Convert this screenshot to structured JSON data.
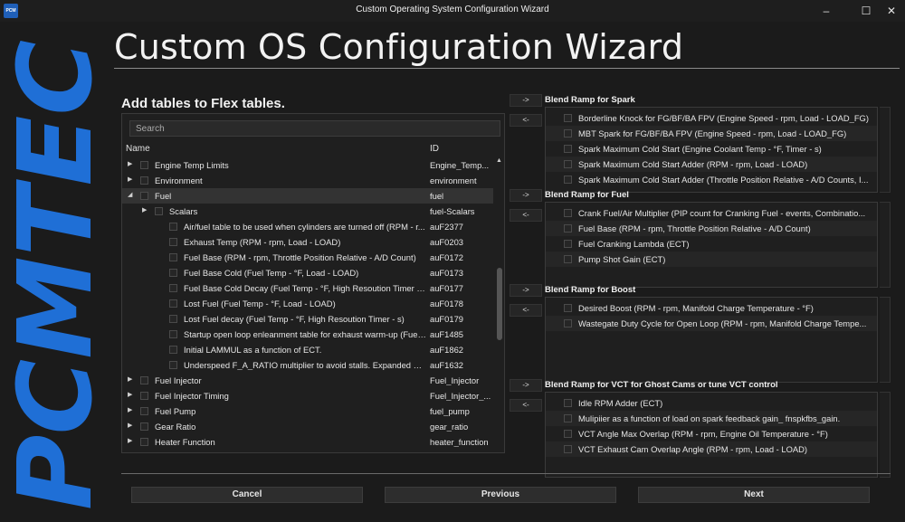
{
  "window": {
    "title": "Custom Operating System Configuration Wizard",
    "icon_text": "PCM",
    "min": "–",
    "max": "☐",
    "close": "✕"
  },
  "logo": {
    "text": "PCMTEC",
    "color": "#1f6fd6"
  },
  "header": {
    "title": "Custom OS Configuration Wizard"
  },
  "tables": {
    "heading": "Add tables to Flex tables.",
    "search_placeholder": "Search",
    "col_name": "Name",
    "col_id": "ID",
    "rows": [
      {
        "name": "Engine Temp Limits",
        "id": "Engine_Temp...",
        "level": 0,
        "expander": "▶"
      },
      {
        "name": "Environment",
        "id": "environment",
        "level": 0,
        "expander": "▶"
      },
      {
        "name": "Fuel",
        "id": "fuel",
        "level": 0,
        "expander": "◢",
        "selected": true
      },
      {
        "name": "Scalars",
        "id": "fuel-Scalars",
        "level": 1,
        "expander": "▶"
      },
      {
        "name": "Air/fuel table to be used when cylinders are turned off (RPM - r...",
        "id": "auF2377",
        "level": 2
      },
      {
        "name": "Exhaust Temp (RPM - rpm, Load - LOAD)",
        "id": "auF0203",
        "level": 2
      },
      {
        "name": "Fuel Base (RPM - rpm, Throttle Position Relative - A/D Count)",
        "id": "auF0172",
        "level": 2
      },
      {
        "name": "Fuel Base Cold (Fuel Temp - °F, Load - LOAD)",
        "id": "auF0173",
        "level": 2
      },
      {
        "name": "Fuel Base Cold Decay (Fuel Temp - °F, High Resoution Timer - s)",
        "id": "auF0177",
        "level": 2
      },
      {
        "name": "Lost Fuel (Fuel Temp - °F, Load - LOAD)",
        "id": "auF0178",
        "level": 2
      },
      {
        "name": "Lost Fuel decay (Fuel Temp - °F, High Resoution Timer - s)",
        "id": "auF0179",
        "level": 2
      },
      {
        "name": "Startup open loop enleanment table for exhaust warm-up  (Fuel...",
        "id": "auF1485",
        "level": 2
      },
      {
        "name": "Initial LAMMUL as a function of ECT.",
        "id": "auF1862",
        "level": 2
      },
      {
        "name": "Underspeed F_A_RATIO multiplier to avoid stalls. Expanded brea...",
        "id": "auF1632",
        "level": 2
      },
      {
        "name": "Fuel Injector",
        "id": "Fuel_Injector",
        "level": 0,
        "expander": "▶"
      },
      {
        "name": "Fuel Injector Timing",
        "id": "Fuel_Injector_...",
        "level": 0,
        "expander": "▶"
      },
      {
        "name": "Fuel Pump",
        "id": "fuel_pump",
        "level": 0,
        "expander": "▶"
      },
      {
        "name": "Gear Ratio",
        "id": "gear_ratio",
        "level": 0,
        "expander": "▶"
      },
      {
        "name": "Heater Function",
        "id": "heater_function",
        "level": 0,
        "expander": "▶"
      }
    ]
  },
  "move": {
    "add": "->",
    "remove": "<-"
  },
  "blends": [
    {
      "title": "Blend Ramp for Spark",
      "items": [
        "Borderline Knock for FG/BF/BA FPV (Engine Speed - rpm, Load - LOAD_FG)",
        "MBT Spark for FG/BF/BA FPV (Engine Speed - rpm, Load - LOAD_FG)",
        "Spark Maximum Cold Start (Engine Coolant Temp - °F, Timer - s)",
        "Spark Maximum Cold Start Adder (RPM - rpm, Load - LOAD)",
        "Spark Maximum Cold Start Adder (Throttle Position Relative - A/D Counts, I..."
      ]
    },
    {
      "title": "Blend Ramp for Fuel",
      "items": [
        "Crank Fuel/Air Multiplier (PIP count for Cranking Fuel - events, Combinatio...",
        "Fuel Base (RPM - rpm, Throttle Position Relative - A/D Count)",
        "Fuel Cranking Lambda (ECT)",
        "Pump Shot Gain (ECT)"
      ]
    },
    {
      "title": "Blend Ramp for Boost",
      "items": [
        "Desired Boost (RPM - rpm, Manifold Charge Temperature - °F)",
        "Wastegate Duty Cycle for Open Loop (RPM - rpm, Manifold Charge Tempe..."
      ]
    },
    {
      "title": "Blend Ramp for VCT for Ghost Cams or tune VCT control",
      "items": [
        "Idle RPM Adder (ECT)",
        "Mulipiier as a function of load on spark feedback gain_ fnspkfbs_gain.",
        "VCT Angle Max Overlap (RPM - rpm, Engine Oil Temperature - °F)",
        "VCT Exhaust Cam Overlap Angle (RPM - rpm, Load - LOAD)"
      ]
    }
  ],
  "footer": {
    "cancel": "Cancel",
    "previous": "Previous",
    "next": "Next"
  }
}
